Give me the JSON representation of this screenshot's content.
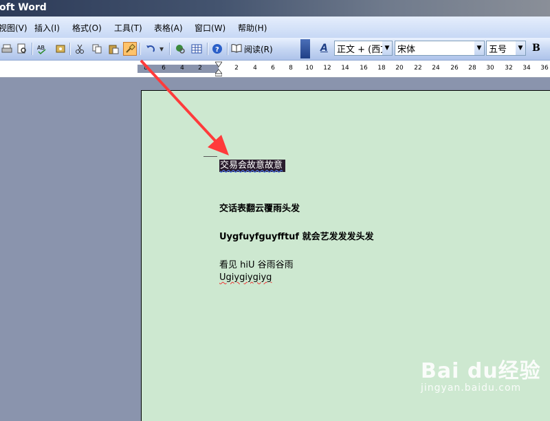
{
  "window": {
    "title": "oft Word"
  },
  "menu": [
    {
      "label": "视图(V)"
    },
    {
      "label": "插入(I)"
    },
    {
      "label": "格式(O)"
    },
    {
      "label": "工具(T)"
    },
    {
      "label": "表格(A)"
    },
    {
      "label": "窗口(W)"
    },
    {
      "label": "帮助(H)"
    }
  ],
  "toolbar": {
    "read_label": "阅读(R)",
    "style_value": "正文 + (西文",
    "font_value": "宋体",
    "size_value": "五号",
    "bold_label": "B",
    "icons": [
      "print-icon",
      "print-preview-icon",
      "spelling-icon",
      "research-icon",
      "cut-icon",
      "copy-icon",
      "paste-icon",
      "format-painter-icon",
      "undo-icon",
      "hyperlink-icon",
      "table-icon",
      "help-icon",
      "read-icon",
      "styles-icon"
    ]
  },
  "ruler": {
    "left_labels": [
      "8",
      "6",
      "4",
      "2"
    ],
    "right_labels": [
      "2",
      "4",
      "6",
      "8",
      "10",
      "12",
      "14",
      "16",
      "18",
      "20",
      "22",
      "24",
      "26",
      "28",
      "30",
      "32",
      "34",
      "36"
    ]
  },
  "document": {
    "selected_line": "交易会故意故意",
    "line2": "交话表翻云覆雨头发",
    "line3": "Uygfuyfguyfftuf 就会艺发发发头发",
    "line4": "看见 hiU 谷雨谷雨",
    "line5": "Ugiygiygiyg"
  },
  "watermark": {
    "logo": "Bai du经验",
    "sub": "jingyan.baidu.com"
  },
  "colors": {
    "page_bg": "#cde8d0",
    "annotation_arrow": "#ff3b3b",
    "format_painter_active": "#ffc36b"
  }
}
